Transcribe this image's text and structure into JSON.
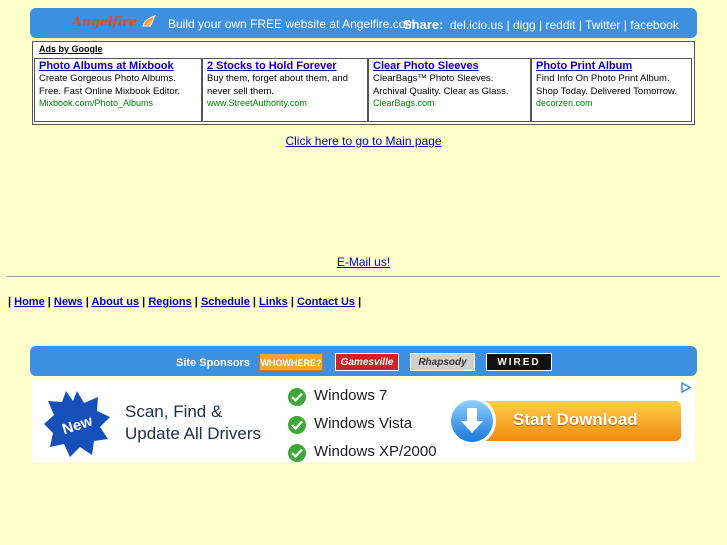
{
  "topbar": {
    "logo": "Angelfire",
    "build_text": "Build your own FREE website at Angelfire.com",
    "share_label": "Share:",
    "share_links": [
      "del.icio.us",
      "digg",
      "reddit",
      "Twitter",
      "facebook"
    ],
    "separator": " | "
  },
  "ads": {
    "header": "Ads by Google",
    "items": [
      {
        "title": "Photo Albums at Mixbook",
        "desc": "Create Gorgeous Photo Albums. Free. Fast Online Mixbook Editor.",
        "url": "Mixbook.com/Photo_Albums"
      },
      {
        "title": "2 Stocks to Hold Forever",
        "desc": "Buy them, forget about them, and never sell them.",
        "url": "www.StreetAuthority.com"
      },
      {
        "title": "Clear Photo Sleeves",
        "desc": "ClearBags™ Photo Sleeves. Archival Quality. Clear as Glass.",
        "url": "ClearBags.com"
      },
      {
        "title": "Photo Print Album",
        "desc": "Find Info On Photo Print Album. Shop Today. Delivered Tomorrow.",
        "url": "decorzen.com"
      }
    ]
  },
  "main_link": "Click here to go to Main page",
  "email_link": "E-Mail us!",
  "nav": {
    "items": [
      "Home",
      "News",
      "About us",
      "Regions",
      "Schedule",
      "Links",
      "Contact Us"
    ]
  },
  "sponsors": {
    "label": "Site Sponsors",
    "logos": [
      "WHOWHERE?",
      "Gamesville",
      "Rhapsody",
      "WIRED"
    ]
  },
  "banner": {
    "badge": "New",
    "line1": "Scan, Find &",
    "line2": "Update All Drivers",
    "os": [
      "Windows 7",
      "Windows Vista",
      "Windows XP/2000"
    ],
    "button": "Start Download"
  },
  "colors": {
    "background": "#ffffcc",
    "bar": "#3d8fe0",
    "link": "#0000cc",
    "ad_url": "#008000"
  }
}
